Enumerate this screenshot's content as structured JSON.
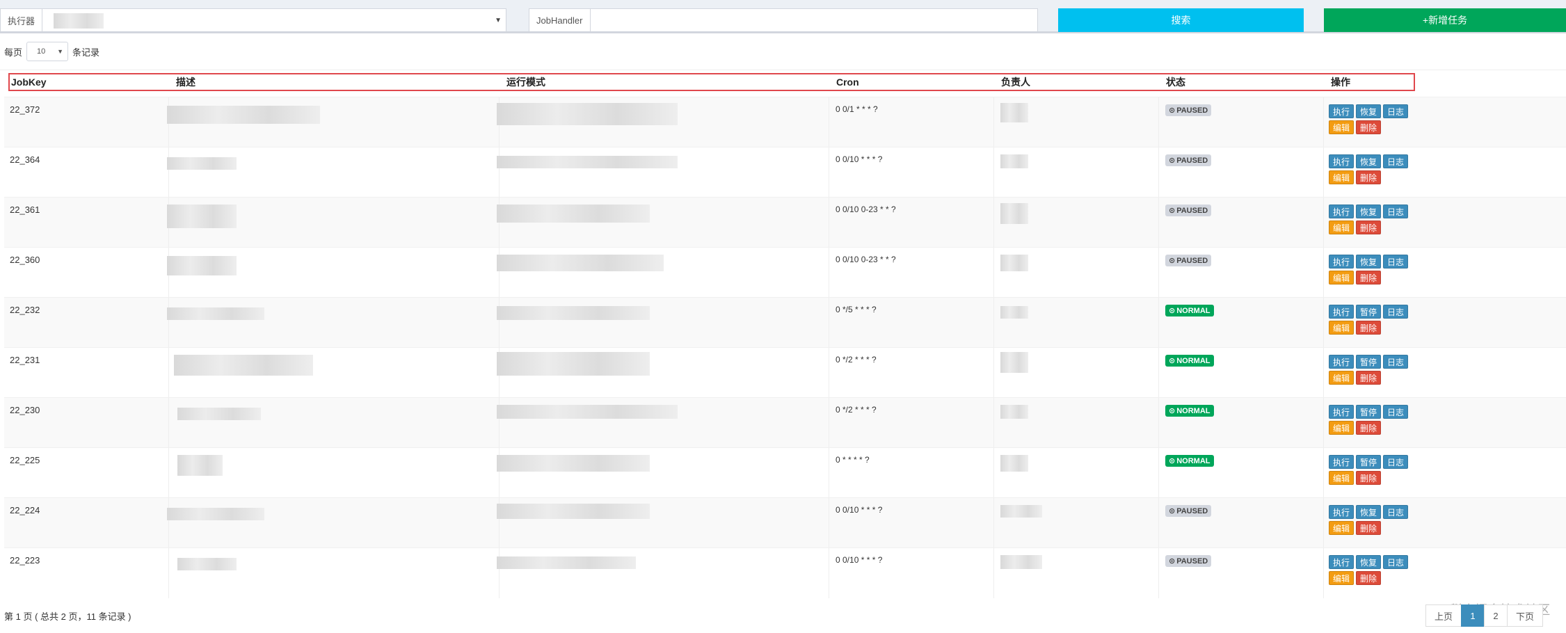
{
  "filters": {
    "executor_label": "执行器",
    "jobhandler_label": "JobHandler",
    "search_button": "搜索",
    "add_button": "+新增任务",
    "colors": {
      "search": "#00c0ef",
      "add": "#00a65a"
    }
  },
  "length": {
    "prefix": "每页",
    "value": "10",
    "suffix": "条记录"
  },
  "table": {
    "headers": [
      "JobKey",
      "描述",
      "运行模式",
      "Cron",
      "负责人",
      "状态",
      "操作"
    ],
    "rows": [
      {
        "jobkey": "22_372",
        "cron": "0 0/1 * * * ?",
        "status": "PAUSED",
        "ops": [
          "执行",
          "恢复",
          "日志",
          "编辑",
          "删除"
        ]
      },
      {
        "jobkey": "22_364",
        "cron": "0 0/10 * * * ?",
        "status": "PAUSED",
        "ops": [
          "执行",
          "恢复",
          "日志",
          "编辑",
          "删除"
        ]
      },
      {
        "jobkey": "22_361",
        "cron": "0 0/10 0-23 * * ?",
        "status": "PAUSED",
        "ops": [
          "执行",
          "恢复",
          "日志",
          "编辑",
          "删除"
        ]
      },
      {
        "jobkey": "22_360",
        "cron": "0 0/10 0-23 * * ?",
        "status": "PAUSED",
        "ops": [
          "执行",
          "恢复",
          "日志",
          "编辑",
          "删除"
        ]
      },
      {
        "jobkey": "22_232",
        "cron": "0 */5 * * * ?",
        "status": "NORMAL",
        "ops": [
          "执行",
          "暂停",
          "日志",
          "编辑",
          "删除"
        ]
      },
      {
        "jobkey": "22_231",
        "cron": "0 */2 * * * ?",
        "status": "NORMAL",
        "ops": [
          "执行",
          "暂停",
          "日志",
          "编辑",
          "删除"
        ]
      },
      {
        "jobkey": "22_230",
        "cron": "0 */2 * * * ?",
        "status": "NORMAL",
        "ops": [
          "执行",
          "暂停",
          "日志",
          "编辑",
          "删除"
        ]
      },
      {
        "jobkey": "22_225",
        "cron": "0 * * * * ?",
        "status": "NORMAL",
        "ops": [
          "执行",
          "暂停",
          "日志",
          "编辑",
          "删除"
        ]
      },
      {
        "jobkey": "22_224",
        "cron": "0 0/10 * * * ?",
        "status": "PAUSED",
        "ops": [
          "执行",
          "恢复",
          "日志",
          "编辑",
          "删除"
        ]
      },
      {
        "jobkey": "22_223",
        "cron": "0 0/10 * * * ?",
        "status": "PAUSED",
        "ops": [
          "执行",
          "恢复",
          "日志",
          "编辑",
          "删除"
        ]
      }
    ]
  },
  "footer": {
    "info": "第 1 页 ( 总共 2 页，11 条记录 )",
    "prev": "上页",
    "pages": [
      "1",
      "2"
    ],
    "next": "下页",
    "watermark": "@稀土掘金技术社区"
  }
}
